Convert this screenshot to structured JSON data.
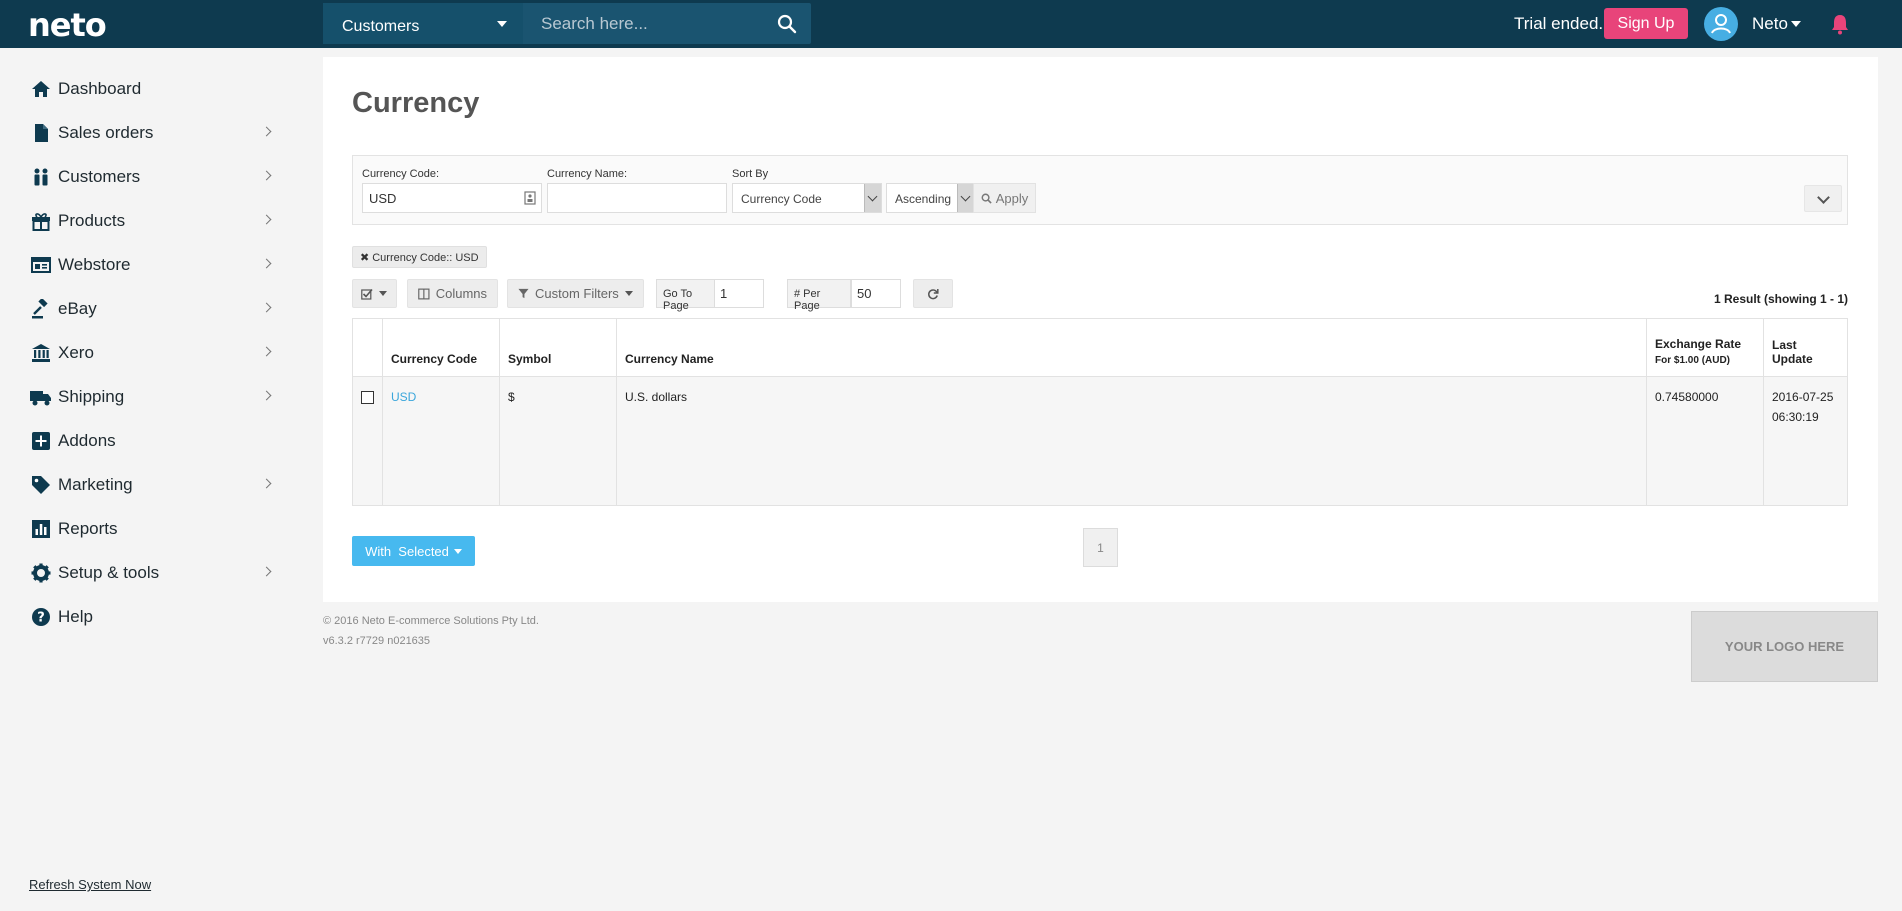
{
  "header": {
    "logo": "neto",
    "search_category": "Customers",
    "search_placeholder": "Search here...",
    "trial_text": "Trial ended.",
    "signup_label": "Sign Up",
    "user_name": "Neto"
  },
  "sidebar": {
    "items": [
      {
        "label": "Dashboard",
        "icon": "home-icon"
      },
      {
        "label": "Sales orders",
        "icon": "file-icon"
      },
      {
        "label": "Customers",
        "icon": "users-icon"
      },
      {
        "label": "Products",
        "icon": "gift-icon"
      },
      {
        "label": "Webstore",
        "icon": "browser-icon"
      },
      {
        "label": "eBay",
        "icon": "gavel-icon"
      },
      {
        "label": "Xero",
        "icon": "bank-icon"
      },
      {
        "label": "Shipping",
        "icon": "truck-icon"
      },
      {
        "label": "Addons",
        "icon": "plus-square-icon"
      },
      {
        "label": "Marketing",
        "icon": "tag-icon"
      },
      {
        "label": "Reports",
        "icon": "bar-chart-icon"
      },
      {
        "label": "Setup & tools",
        "icon": "gear-icon"
      },
      {
        "label": "Help",
        "icon": "question-icon"
      }
    ],
    "refresh_label": "Refresh System Now"
  },
  "page": {
    "title": "Currency",
    "filters": {
      "code_label": "Currency Code:",
      "code_value": "USD",
      "name_label": "Currency Name:",
      "name_value": "",
      "sort_label": "Sort By",
      "sort_value": "Currency Code",
      "order_value": "Ascending",
      "apply_label": "Apply"
    },
    "active_filter": "Currency Code:: USD",
    "toolbar": {
      "columns_label": "Columns",
      "custom_filters_label": "Custom Filters",
      "goto_label": "Go To Page",
      "goto_value": "1",
      "per_page_label": "# Per Page",
      "per_page_value": "50"
    },
    "results_text": "1 Result (showing 1 - 1)",
    "table": {
      "headers": {
        "code": "Currency Code",
        "symbol": "Symbol",
        "name": "Currency Name",
        "rate": "Exchange Rate",
        "rate_sub": "For $1.00 (AUD)",
        "updated": "Last Update"
      },
      "rows": [
        {
          "code": "USD",
          "symbol": "$",
          "name": "U.S. dollars",
          "rate": "0.74580000",
          "updated_date": "2016-07-25",
          "updated_time": "06:30:19"
        }
      ]
    },
    "with_selected_label": "With  Selected",
    "current_page": "1"
  },
  "footer": {
    "copyright": "© 2016 Neto E-commerce Solutions Pty Ltd.",
    "version": "v6.3.2 r7729 n021635",
    "logo_placeholder": "YOUR LOGO HERE"
  },
  "colors": {
    "topbar": "#0e3a4f",
    "signup": "#e8447a",
    "accent": "#47b9ef",
    "bell": "#e8447a"
  }
}
